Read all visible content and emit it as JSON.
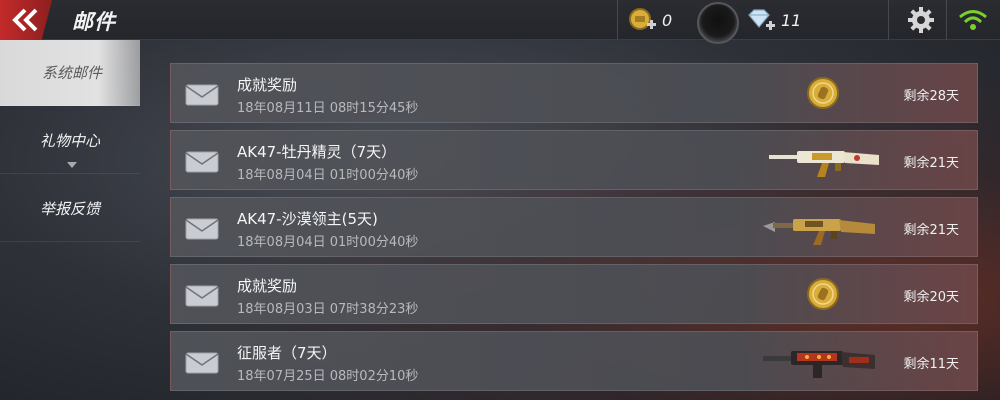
{
  "header": {
    "title": "邮件",
    "coins": "0",
    "diamonds": "11"
  },
  "sidebar": {
    "items": [
      {
        "label": "系统邮件",
        "active": true
      },
      {
        "label": "礼物中心",
        "active": false
      },
      {
        "label": "举报反馈",
        "active": false
      }
    ]
  },
  "mails": [
    {
      "subject": "成就奖励",
      "date": "18年08月11日 08时15分45秒",
      "remaining": "剩余28天",
      "reward_icon": "gold-coin-icon"
    },
    {
      "subject": "AK47-牡丹精灵（7天）",
      "date": "18年08月04日 01时00分40秒",
      "remaining": "剩余21天",
      "reward_icon": "ak47-peony-gun-icon"
    },
    {
      "subject": "AK47-沙漠领主(5天)",
      "date": "18年08月04日 01时00分40秒",
      "remaining": "剩余21天",
      "reward_icon": "ak47-desert-gun-icon"
    },
    {
      "subject": "成就奖励",
      "date": "18年08月03日 07时38分23秒",
      "remaining": "剩余20天",
      "reward_icon": "gold-coin-icon"
    },
    {
      "subject": "征服者（7天）",
      "date": "18年07月25日 08时02分10秒",
      "remaining": "剩余11天",
      "reward_icon": "conqueror-gun-icon"
    }
  ],
  "colors": {
    "accent_red": "#c42a2a",
    "wifi_green": "#7bd12a",
    "coin_gold": "#d9ad3a"
  }
}
